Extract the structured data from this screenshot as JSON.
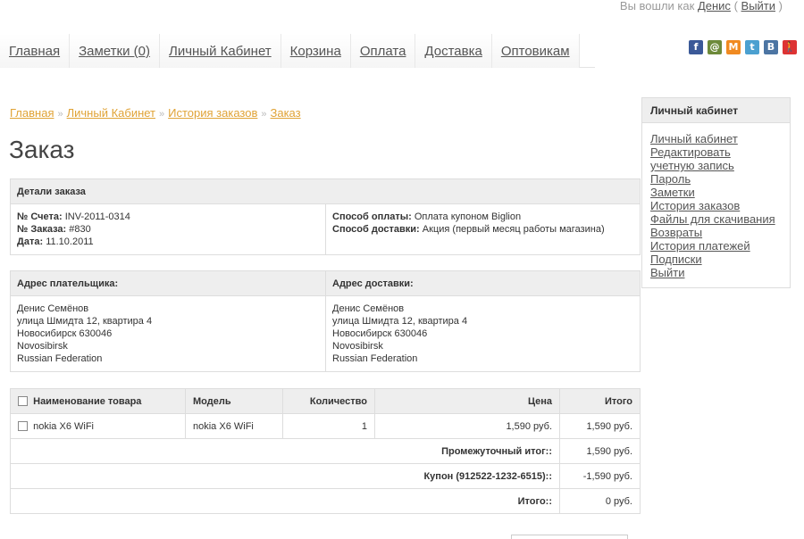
{
  "topbar": {
    "prefix": "Вы вошли как",
    "user": "Денис",
    "open": "(",
    "logout": "Выйти",
    "close": ")"
  },
  "nav": [
    "Главная",
    "Заметки (0)",
    "Личный Кабинет",
    "Корзина",
    "Оплата",
    "Доставка",
    "Оптовикам"
  ],
  "social": [
    {
      "name": "facebook-icon",
      "glyph": "f",
      "color": "#3b5998"
    },
    {
      "name": "odnoklassniki-icon",
      "glyph": "@",
      "color": "#6d8a3a"
    },
    {
      "name": "moimir-icon",
      "glyph": "M",
      "color": "#f08a21"
    },
    {
      "name": "twitter-icon",
      "glyph": "t",
      "color": "#4ba0d0"
    },
    {
      "name": "vkontakte-icon",
      "glyph": "B",
      "color": "#4c75a3"
    },
    {
      "name": "person-icon",
      "glyph": "🚶",
      "color": "#d33"
    }
  ],
  "breadcrumb": {
    "items": [
      "Главная",
      "Личный Кабинет",
      "История заказов",
      "Заказ"
    ],
    "sep": "»"
  },
  "page_title": "Заказ",
  "details": {
    "header": "Детали заказа",
    "invoice_label": "№ Счета:",
    "invoice": "INV-2011-0314",
    "order_label": "№ Заказа:",
    "order": "#830",
    "date_label": "Дата:",
    "date": "11.10.2011",
    "payment_label": "Способ оплаты:",
    "payment": "Оплата купоном Biglion",
    "shipping_label": "Способ доставки:",
    "shipping": "Акция (первый месяц работы магазина)"
  },
  "address": {
    "payer_header": "Адрес плательщика:",
    "shipping_header": "Адрес доставки:",
    "payer": [
      "Денис Семёнов",
      "улица Шмидта 12, квартира 4",
      "Новосибирск 630046",
      "Novosibirsk",
      "Russian Federation"
    ],
    "shipping": [
      "Денис Семёнов",
      "улица Шмидта 12, квартира 4",
      "Новосибирск 630046",
      "Novosibirsk",
      "Russian Federation"
    ]
  },
  "products": {
    "headers": {
      "name": "Наименование товара",
      "model": "Модель",
      "qty": "Количество",
      "price": "Цена",
      "total": "Итого"
    },
    "rows": [
      {
        "name": "nokia X6 WiFi",
        "model": "nokia X6 WiFi",
        "qty": "1",
        "price": "1,590 руб.",
        "total": "1,590 руб."
      }
    ],
    "totals": [
      {
        "label": "Промежуточный итог::",
        "value": "1,590 руб."
      },
      {
        "label": "Купон (912522-1232-6515)::",
        "value": "-1,590 руб."
      },
      {
        "label": "Итого::",
        "value": "0 руб."
      }
    ]
  },
  "sidebar": {
    "title": "Личный кабинет",
    "links": [
      "Личный кабинет",
      "Редактировать",
      "учетную запись",
      "Пароль",
      "Заметки",
      "История заказов",
      "Файлы для скачивания",
      "Возвраты",
      "История платежей",
      "Подписки",
      "Выйти"
    ]
  }
}
